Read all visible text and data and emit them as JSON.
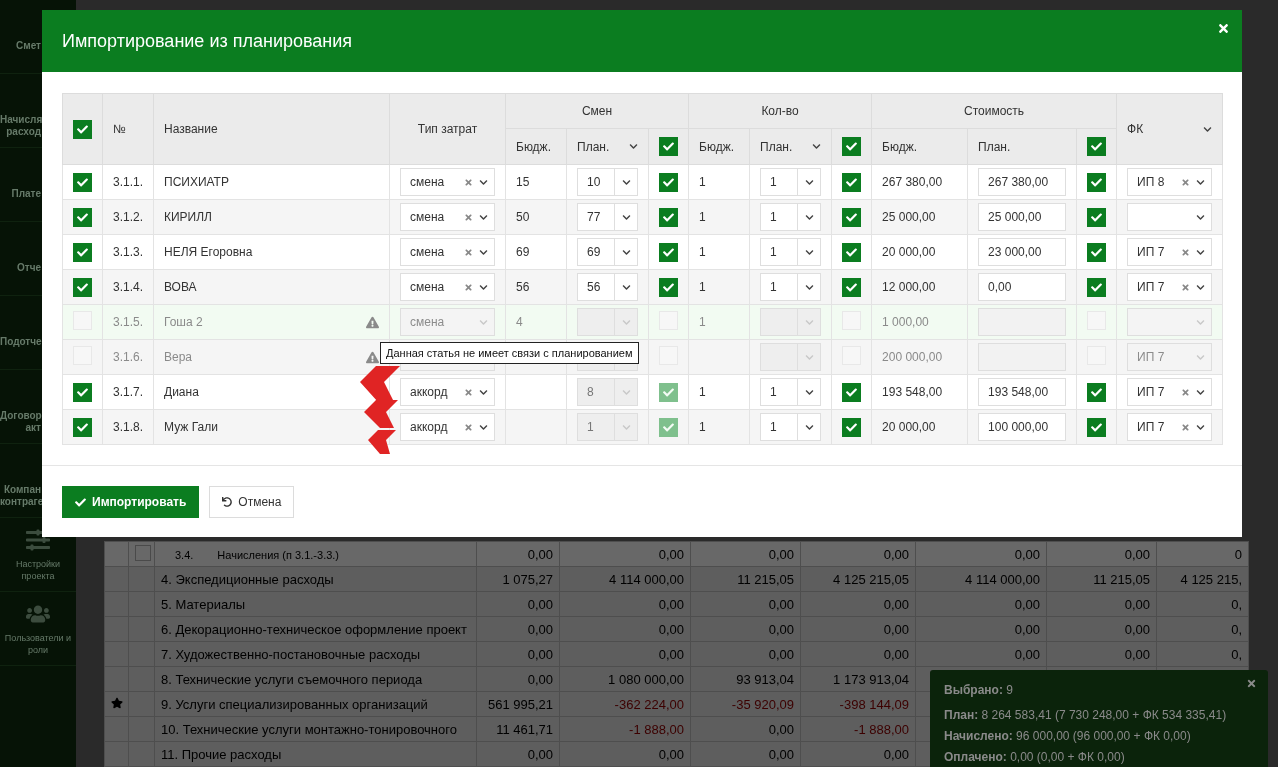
{
  "sidebar": {
    "items": [
      {
        "lines": [
          "Смет"
        ],
        "cut": true
      },
      {
        "lines": [
          "Начисля",
          "расход"
        ],
        "cut": true
      },
      {
        "lines": [
          "Плате"
        ],
        "cut": true
      },
      {
        "lines": [
          "Отче"
        ],
        "cut": true
      },
      {
        "lines": [
          "Подотче"
        ],
        "cut": true
      },
      {
        "lines": [
          "Договор",
          "акт"
        ],
        "cut": true
      },
      {
        "lines": [
          "Компан",
          "контраге"
        ],
        "cut": true
      },
      {
        "lines": [
          "Настройки",
          "проекта"
        ],
        "cut": false
      },
      {
        "lines": [
          "Пользователи и",
          "роли"
        ],
        "cut": false
      }
    ]
  },
  "background_table": {
    "rows": [
      {
        "kind": "sub",
        "starred": false,
        "num": "3.4.",
        "name": "Начисления (п 3.1.-3.3.)",
        "values": [
          "0,00",
          "0,00",
          "0,00",
          "0,00",
          "0,00",
          "0,00",
          "0"
        ]
      },
      {
        "kind": "main",
        "starred": false,
        "name": "4. Экспедиционные расходы",
        "values": [
          "1 075,27",
          "4 114 000,00",
          "11 215,05",
          "4 125 215,05",
          "4 114 000,00",
          "11 215,05",
          "4 125 215,"
        ]
      },
      {
        "kind": "main",
        "starred": false,
        "name": "5. Материалы",
        "values": [
          "0,00",
          "0,00",
          "0,00",
          "0,00",
          "0,00",
          "0,00",
          "0,"
        ]
      },
      {
        "kind": "main",
        "starred": false,
        "name": "6. Декорационно-техническое оформление проект",
        "values": [
          "0,00",
          "0,00",
          "0,00",
          "0,00",
          "0,00",
          "0,00",
          "0,"
        ]
      },
      {
        "kind": "main",
        "starred": false,
        "name": "7. Художественно-постановочные расходы",
        "values": [
          "0,00",
          "0,00",
          "0,00",
          "0,00",
          "0,00",
          "0,00",
          "0,"
        ]
      },
      {
        "kind": "main",
        "starred": false,
        "name": "8. Технические услуги съемочного периода",
        "values": [
          "0,00",
          "1 080 000,00",
          "93 913,04",
          "1 173 913,04"
        ]
      },
      {
        "kind": "main",
        "starred": true,
        "name": "9. Услуги специализированных организаций",
        "values": [
          "561 995,21",
          {
            "text": "-362 224,00",
            "negative": true
          },
          {
            "text": "-35 920,09",
            "negative": true
          },
          {
            "text": "-398 144,09",
            "negative": true
          }
        ]
      },
      {
        "kind": "main",
        "starred": false,
        "name": "10. Технические услуги монтажно-тонировочного",
        "values": [
          "11 461,71",
          {
            "text": "-1 888,00",
            "negative": true
          },
          "0,00",
          {
            "text": "-1 888,00",
            "negative": true
          }
        ]
      },
      {
        "kind": "main",
        "starred": false,
        "name": "11. Прочие расходы",
        "values": [
          "0,00",
          "0,00",
          "0,00",
          "0,00"
        ]
      }
    ]
  },
  "modal": {
    "title": "Импортирование из планирования",
    "table": {
      "header": {
        "select_all": true,
        "num": "№",
        "name": "Название",
        "type": "Тип затрат",
        "fk": "ФК",
        "groups": [
          {
            "title": "Смен",
            "budget": "Бюдж.",
            "plan": "План.",
            "plan_menu": true,
            "checked": true
          },
          {
            "title": "Кол-во",
            "budget": "Бюдж.",
            "plan": "План.",
            "plan_menu": true,
            "checked": true
          },
          {
            "title": "Стоимость",
            "budget": "Бюдж.",
            "plan": "План.",
            "plan_menu": false,
            "checked": true
          }
        ]
      },
      "rows": [
        {
          "selected": true,
          "disabled": false,
          "highlighted": false,
          "warning": false,
          "num": "3.1.1.",
          "name": "ПСИХИАТР",
          "type": {
            "value": "смена",
            "clearable": true
          },
          "groups": [
            {
              "kind": "select",
              "budget": "15",
              "plan": "10",
              "plan_disabled": false,
              "checked": true,
              "muted": false
            },
            {
              "kind": "select",
              "budget": "1",
              "plan": "1",
              "plan_disabled": false,
              "checked": true,
              "muted": false
            },
            {
              "kind": "input",
              "budget": "267 380,00",
              "plan": "267 380,00",
              "plan_disabled": false,
              "checked": true,
              "muted": false
            }
          ],
          "fk": {
            "value": "ИП 8",
            "clearable": true
          }
        },
        {
          "selected": true,
          "disabled": false,
          "highlighted": false,
          "warning": false,
          "num": "3.1.2.",
          "name": "КИРИЛЛ",
          "type": {
            "value": "смена",
            "clearable": true
          },
          "groups": [
            {
              "kind": "select",
              "budget": "50",
              "plan": "77",
              "plan_disabled": false,
              "checked": true,
              "muted": false
            },
            {
              "kind": "select",
              "budget": "1",
              "plan": "1",
              "plan_disabled": false,
              "checked": true,
              "muted": false
            },
            {
              "kind": "input",
              "budget": "25 000,00",
              "plan": "25 000,00",
              "plan_disabled": false,
              "checked": true,
              "muted": false
            }
          ],
          "fk": {
            "clearable": false
          }
        },
        {
          "selected": true,
          "disabled": false,
          "highlighted": false,
          "warning": false,
          "num": "3.1.3.",
          "name": "НЕЛЯ Егоровна",
          "type": {
            "value": "смена",
            "clearable": true
          },
          "groups": [
            {
              "kind": "select",
              "budget": "69",
              "plan": "69",
              "plan_disabled": false,
              "checked": true,
              "muted": false
            },
            {
              "kind": "select",
              "budget": "1",
              "plan": "1",
              "plan_disabled": false,
              "checked": true,
              "muted": false
            },
            {
              "kind": "input",
              "budget": "20 000,00",
              "plan": "23 000,00",
              "plan_disabled": false,
              "checked": true,
              "muted": false
            }
          ],
          "fk": {
            "value": "ИП 7",
            "clearable": true
          }
        },
        {
          "selected": true,
          "disabled": false,
          "highlighted": false,
          "warning": false,
          "num": "3.1.4.",
          "name": "ВОВА",
          "type": {
            "value": "смена",
            "clearable": true
          },
          "groups": [
            {
              "kind": "select",
              "budget": "56",
              "plan": "56",
              "plan_disabled": false,
              "checked": true,
              "muted": false
            },
            {
              "kind": "select",
              "budget": "1",
              "plan": "1",
              "plan_disabled": false,
              "checked": true,
              "muted": false
            },
            {
              "kind": "input",
              "budget": "12 000,00",
              "plan": "0,00",
              "plan_disabled": false,
              "checked": true,
              "muted": false
            }
          ],
          "fk": {
            "value": "ИП 7",
            "clearable": true
          }
        },
        {
          "selected": false,
          "disabled": true,
          "highlighted": true,
          "warning": true,
          "num": "3.1.5.",
          "name": "Гоша 2",
          "type": {
            "value": "смена",
            "clearable": false
          },
          "groups": [
            {
              "kind": "select",
              "budget": "4",
              "plan_disabled": true,
              "checked": false
            },
            {
              "kind": "select",
              "budget": "1",
              "plan_disabled": true,
              "checked": false
            },
            {
              "kind": "input",
              "budget": "1 000,00",
              "plan_disabled": true,
              "checked": false
            }
          ],
          "fk": {
            "clearable": false
          }
        },
        {
          "selected": false,
          "disabled": true,
          "highlighted": false,
          "warning": true,
          "num": "3.1.6.",
          "name": "Вера",
          "groups": [
            {
              "kind": "select",
              "plan_disabled": true,
              "checked": false
            },
            {
              "kind": "select",
              "plan_disabled": true,
              "checked": false
            },
            {
              "kind": "input",
              "budget": "200 000,00",
              "plan_disabled": true,
              "checked": false
            }
          ],
          "fk": {
            "value": "ИП 7",
            "clearable": false
          }
        },
        {
          "selected": true,
          "disabled": false,
          "highlighted": false,
          "warning": false,
          "num": "3.1.7.",
          "name": "Диана",
          "type": {
            "value": "аккорд",
            "clearable": true
          },
          "groups": [
            {
              "kind": "select",
              "plan": "8",
              "plan_disabled": true,
              "checked": true,
              "muted": true
            },
            {
              "kind": "select",
              "budget": "1",
              "plan": "1",
              "plan_disabled": false,
              "checked": true,
              "muted": false
            },
            {
              "kind": "input",
              "budget": "193 548,00",
              "plan": "193 548,00",
              "plan_disabled": false,
              "checked": true,
              "muted": false
            }
          ],
          "fk": {
            "value": "ИП 7",
            "clearable": true
          }
        },
        {
          "selected": true,
          "disabled": false,
          "highlighted": false,
          "warning": false,
          "num": "3.1.8.",
          "name": "Муж Гали",
          "type": {
            "value": "аккорд",
            "clearable": true
          },
          "groups": [
            {
              "kind": "select",
              "plan": "1",
              "plan_disabled": true,
              "checked": true,
              "muted": true
            },
            {
              "kind": "select",
              "budget": "1",
              "plan": "1",
              "plan_disabled": false,
              "checked": true,
              "muted": false
            },
            {
              "kind": "input",
              "budget": "20 000,00",
              "plan": "100 000,00",
              "plan_disabled": false,
              "checked": true,
              "muted": false
            }
          ],
          "fk": {
            "value": "ИП 7",
            "clearable": true
          }
        }
      ]
    },
    "buttons": [
      {
        "label": "Импортировать",
        "kind": "primary"
      },
      {
        "label": "Отмена",
        "kind": "cancel"
      }
    ]
  },
  "tooltip": {
    "text": "Данная статья не имеет связи с планированием"
  },
  "summary": {
    "lines": [
      "**Выбрано:** 9",
      "**План:** 8 264 583,41 (7 730 248,00 + ФК 534 335,41)",
      "**Начислено:** 96 000,00 (96 000,00 + ФК 0,00)",
      "**Оплачено:** 0,00 (0,00 + ФК 0,00)"
    ]
  }
}
